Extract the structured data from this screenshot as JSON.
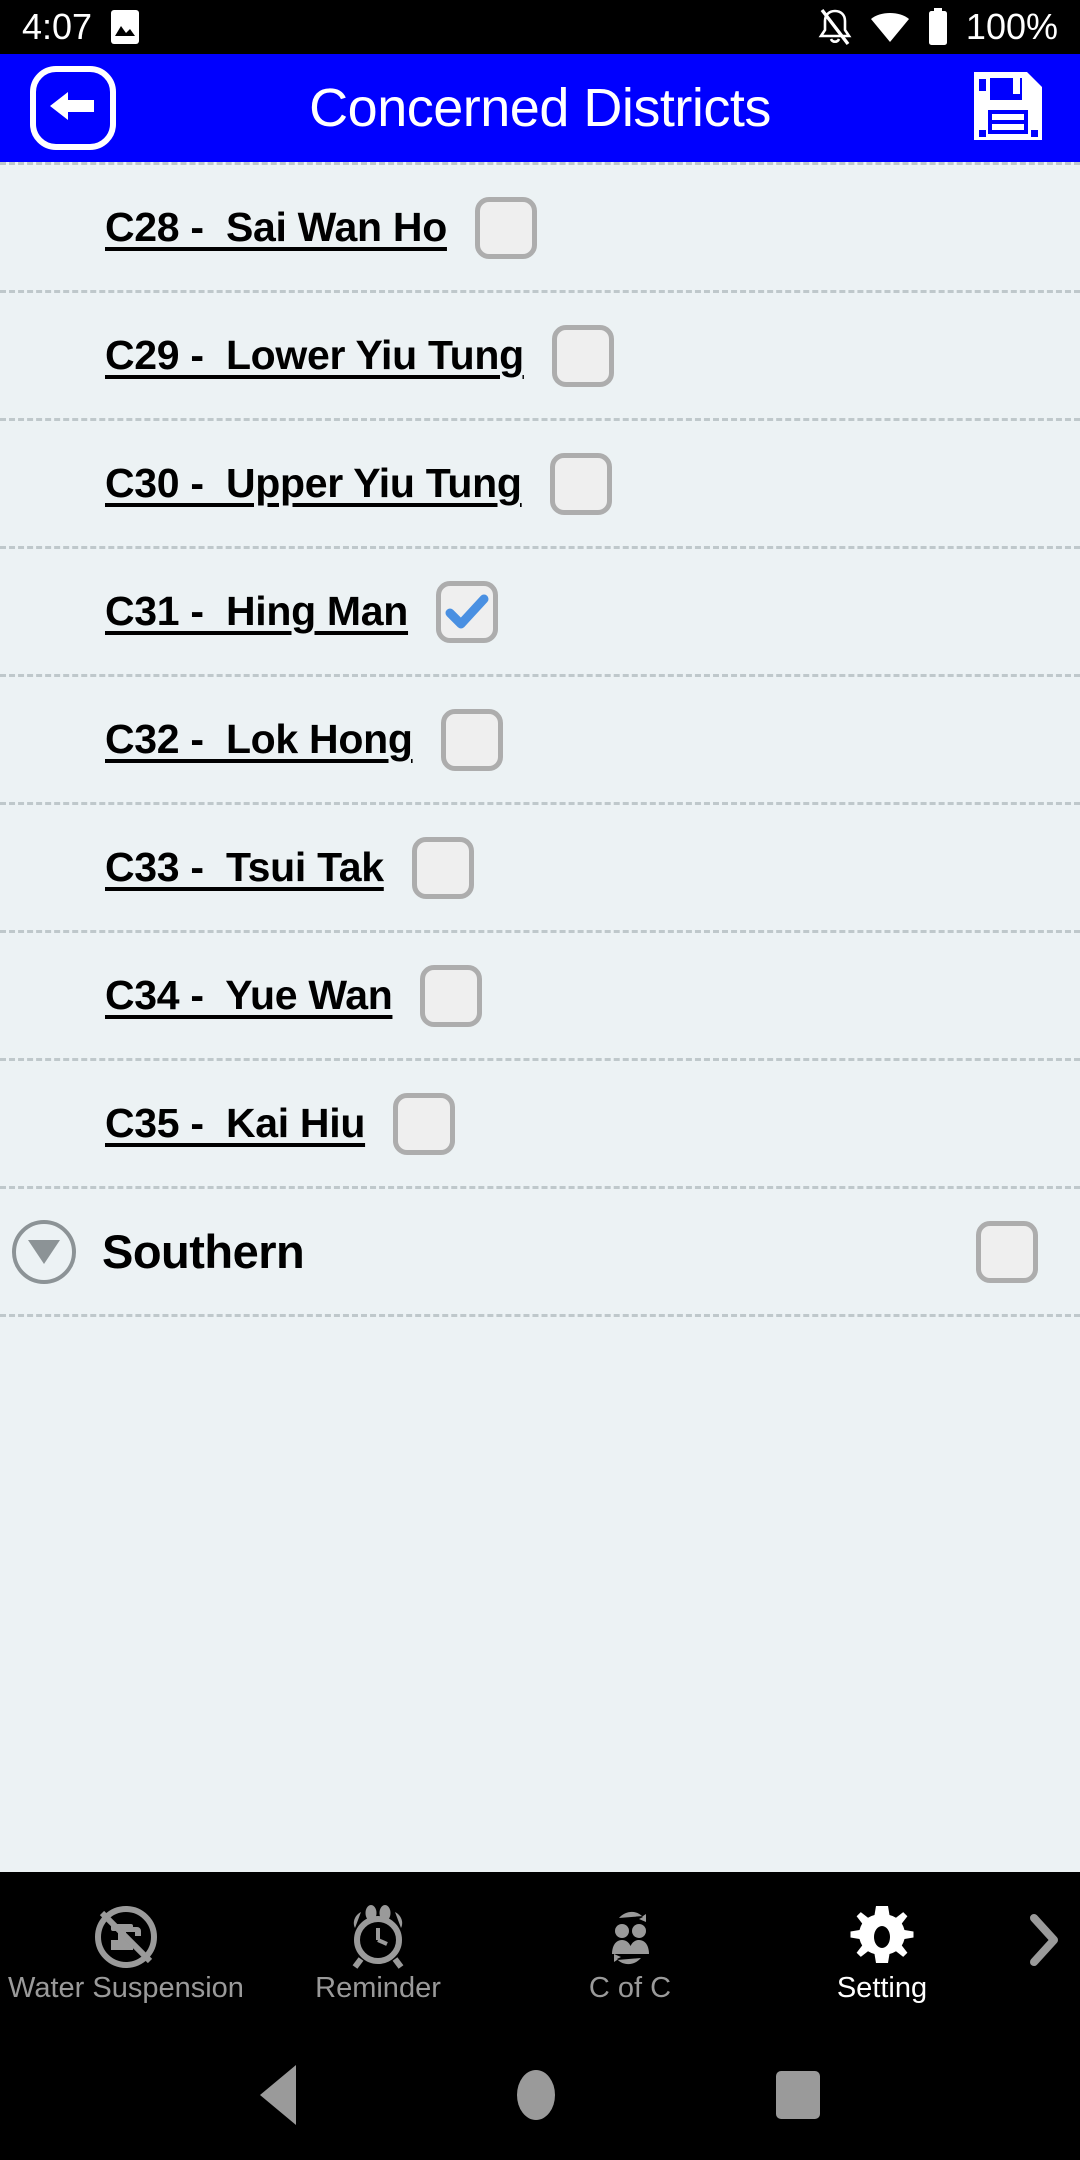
{
  "status_bar": {
    "time": "4:07",
    "battery_percent": "100%",
    "icons": [
      "image-icon",
      "notifications-off-icon",
      "wifi-icon",
      "battery-full-icon"
    ]
  },
  "appbar": {
    "title": "Concerned Districts",
    "back_icon": "arrow-left-icon",
    "save_icon": "floppy-disk-save-icon",
    "background_color": "#0000FF",
    "text_color": "#FFFFFF"
  },
  "list": {
    "background_color": "#ECF2F4",
    "checked_color": "#4A90E2",
    "rows": [
      {
        "label": "C28 -  Sai Wan Ho",
        "checked": false
      },
      {
        "label": "C29 -  Lower Yiu Tung",
        "checked": false
      },
      {
        "label": "C30 -  Upper Yiu Tung",
        "checked": false
      },
      {
        "label": "C31 -  Hing Man",
        "checked": true
      },
      {
        "label": "C32 -  Lok Hong",
        "checked": false
      },
      {
        "label": "C33 -  Tsui Tak",
        "checked": false
      },
      {
        "label": "C34 -  Yue Wan",
        "checked": false
      },
      {
        "label": "C35 -  Kai Hiu",
        "checked": false
      }
    ],
    "group": {
      "label": "Southern",
      "expander_icon": "chevron-down-circle-icon",
      "checked": false
    }
  },
  "tabbar": {
    "items": [
      {
        "label": "Water Suspension",
        "icon": "no-water-tap-icon",
        "active": false
      },
      {
        "label": "Reminder",
        "icon": "alarm-clock-icon",
        "active": false
      },
      {
        "label": "C of C",
        "icon": "change-of-customer-icon",
        "active": false
      },
      {
        "label": "Setting",
        "icon": "gear-icon",
        "active": true
      }
    ],
    "more_icon": "chevron-right-icon",
    "active_color": "#FFFFFF",
    "inactive_color": "#9A9A9A"
  },
  "navbar": {
    "back": "triangle-back-icon",
    "home": "circle-home-icon",
    "recents": "square-recents-icon"
  }
}
